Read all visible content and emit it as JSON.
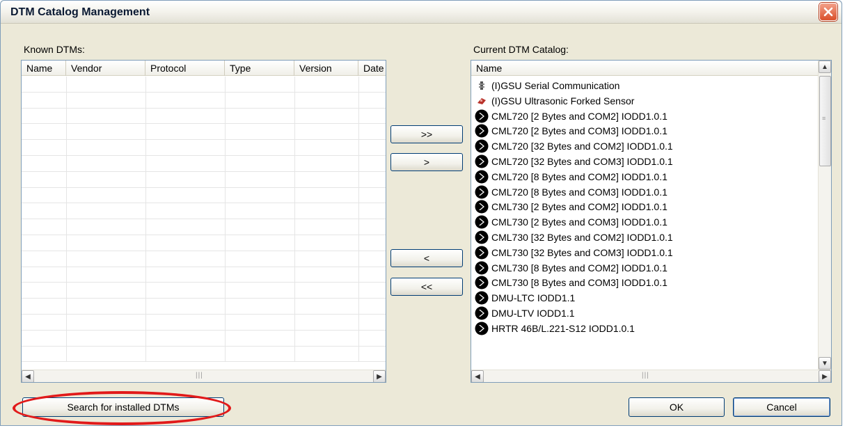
{
  "window": {
    "title": "DTM Catalog Management"
  },
  "known": {
    "label": "Known DTMs:",
    "columns": [
      "Name",
      "Vendor",
      "Protocol",
      "Type",
      "Version",
      "Date"
    ],
    "empty_rows": 18
  },
  "current": {
    "label": "Current DTM Catalog:",
    "column": "Name",
    "items": [
      {
        "text": "(I)GSU Serial Communication",
        "icon": "connector-icon"
      },
      {
        "text": "(I)GSU Ultrasonic Forked Sensor",
        "icon": "sensor-icon"
      },
      {
        "text": "CML720 [2 Bytes and COM2] IODD1.0.1",
        "icon": "iolink-icon"
      },
      {
        "text": "CML720 [2 Bytes and COM3] IODD1.0.1",
        "icon": "iolink-icon"
      },
      {
        "text": "CML720 [32 Bytes and COM2] IODD1.0.1",
        "icon": "iolink-icon"
      },
      {
        "text": "CML720 [32 Bytes and COM3] IODD1.0.1",
        "icon": "iolink-icon"
      },
      {
        "text": "CML720 [8 Bytes and COM2] IODD1.0.1",
        "icon": "iolink-icon"
      },
      {
        "text": "CML720 [8 Bytes and COM3] IODD1.0.1",
        "icon": "iolink-icon"
      },
      {
        "text": "CML730 [2 Bytes and COM2] IODD1.0.1",
        "icon": "iolink-icon"
      },
      {
        "text": "CML730 [2 Bytes and COM3] IODD1.0.1",
        "icon": "iolink-icon"
      },
      {
        "text": "CML730 [32 Bytes and COM2] IODD1.0.1",
        "icon": "iolink-icon"
      },
      {
        "text": "CML730 [32 Bytes and COM3] IODD1.0.1",
        "icon": "iolink-icon"
      },
      {
        "text": "CML730 [8 Bytes and COM2] IODD1.0.1",
        "icon": "iolink-icon"
      },
      {
        "text": "CML730 [8 Bytes and COM3] IODD1.0.1",
        "icon": "iolink-icon"
      },
      {
        "text": "DMU-LTC IODD1.1",
        "icon": "iolink-icon"
      },
      {
        "text": "DMU-LTV IODD1.1",
        "icon": "iolink-icon"
      },
      {
        "text": "HRTR 46B/L.221-S12 IODD1.0.1",
        "icon": "iolink-icon"
      }
    ]
  },
  "transfer": {
    "add_all": ">>",
    "add": ">",
    "remove": "<",
    "remove_all": "<<"
  },
  "footer": {
    "search_label": "Search for installed DTMs",
    "ok_label": "OK",
    "cancel_label": "Cancel"
  },
  "colors": {
    "highlight": "#e11a1a",
    "border": "#7f9db9",
    "face": "#ece9d8"
  }
}
